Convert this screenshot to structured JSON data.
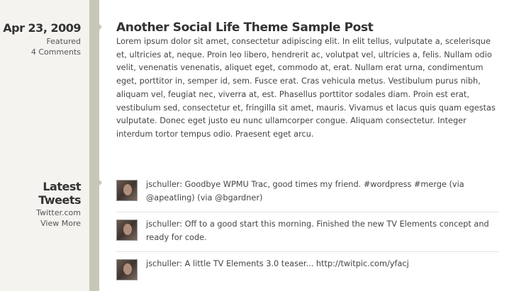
{
  "post_meta": {
    "date": "Apr 23, 2009",
    "category": "Featured",
    "comments": "4 Comments"
  },
  "post": {
    "title": "Another Social Life Theme Sample Post",
    "body": "Lorem ipsum dolor sit amet, consectetur adipiscing elit. In elit tellus, vulputate a, scelerisque et, ultricies at, neque. Proin leo libero, hendrerit ac, volutpat vel, ultricies a, felis. Nullam odio velit, venenatis venenatis, aliquet eget, commodo at, erat. Nullam erat urna, condimentum eget, porttitor in, semper id, sem. Fusce erat. Cras vehicula metus. Vestibulum purus nibh, aliquam vel, feugiat nec, viverra at, est. Phasellus porttitor sodales diam. Proin est erat, vestibulum sed, consectetur et, fringilla sit amet, mauris. Vivamus et lacus quis quam egestas vulputate. Donec eget justo eu nunc ullamcorper congue. Aliquam consectetur. Integer interdum tortor tempus odio. Praesent eget arcu."
  },
  "tweets_meta": {
    "title": "Latest Tweets",
    "source": "Twitter.com",
    "more": "View More"
  },
  "tweets": [
    {
      "text": "jschuller: Goodbye WPMU Trac, good times my friend. #wordpress #merge (via @apeatling) (via @bgardner)"
    },
    {
      "text": "jschuller: Off to a good start this morning. Finished the new TV Elements concept and ready for code."
    },
    {
      "text": "jschuller: A little TV Elements 3.0 teaser... http://twitpic.com/yfacj"
    }
  ],
  "colors": {
    "rail": "#c8c6b6",
    "background": "#f4f3ef",
    "content": "#ffffff"
  }
}
